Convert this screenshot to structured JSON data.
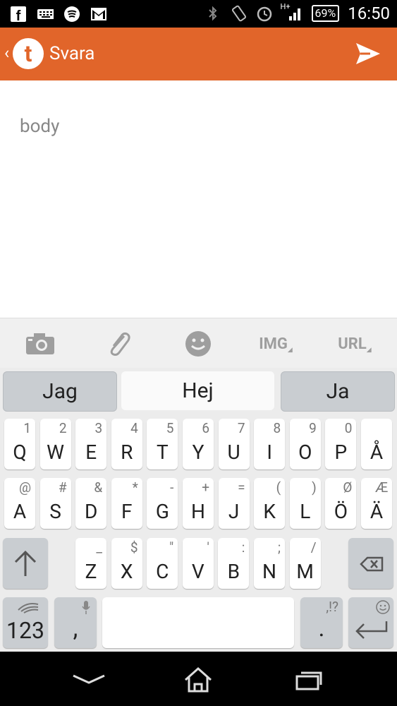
{
  "status_bar": {
    "left_icons": [
      "facebook-icon",
      "keyboard-icon",
      "spotify-icon",
      "gmail-icon"
    ],
    "right_icons": [
      "bluetooth-icon",
      "rotate-icon",
      "alarm-icon",
      "signal-icon"
    ],
    "network_label": "H+",
    "battery": "69%",
    "time": "16:50"
  },
  "app_bar": {
    "logo_letter": "t",
    "title": "Svara",
    "accent_color": "#e1652a"
  },
  "compose": {
    "placeholder": "body"
  },
  "toolbar": {
    "items": [
      "camera-icon",
      "attachment-icon",
      "emoji-icon",
      "IMG",
      "URL"
    ]
  },
  "keyboard": {
    "suggestions": [
      "Jag",
      "Hej",
      "Ja"
    ],
    "row1": [
      {
        "main": "Q",
        "sub": "1"
      },
      {
        "main": "W",
        "sub": "2"
      },
      {
        "main": "E",
        "sub": "3"
      },
      {
        "main": "R",
        "sub": "4"
      },
      {
        "main": "T",
        "sub": "5"
      },
      {
        "main": "Y",
        "sub": "6"
      },
      {
        "main": "U",
        "sub": "7"
      },
      {
        "main": "I",
        "sub": "8"
      },
      {
        "main": "O",
        "sub": "9"
      },
      {
        "main": "P",
        "sub": "0"
      },
      {
        "main": "Å",
        "sub": ""
      }
    ],
    "row2": [
      {
        "main": "A",
        "sub": "@"
      },
      {
        "main": "S",
        "sub": "#"
      },
      {
        "main": "D",
        "sub": "&"
      },
      {
        "main": "F",
        "sub": "*"
      },
      {
        "main": "G",
        "sub": "-"
      },
      {
        "main": "H",
        "sub": "+"
      },
      {
        "main": "J",
        "sub": "="
      },
      {
        "main": "K",
        "sub": "("
      },
      {
        "main": "L",
        "sub": ")"
      },
      {
        "main": "Ö",
        "sub": "Ø"
      },
      {
        "main": "Ä",
        "sub": "Æ"
      }
    ],
    "row3": [
      {
        "main": "Z",
        "sub": "_"
      },
      {
        "main": "X",
        "sub": "$"
      },
      {
        "main": "C",
        "sub": "\""
      },
      {
        "main": "V",
        "sub": "'"
      },
      {
        "main": "B",
        "sub": ":"
      },
      {
        "main": "N",
        "sub": ";"
      },
      {
        "main": "M",
        "sub": "/"
      }
    ],
    "num_label": "123",
    "comma_label": ",",
    "period_label": ".",
    "period_sub": ",!?"
  }
}
